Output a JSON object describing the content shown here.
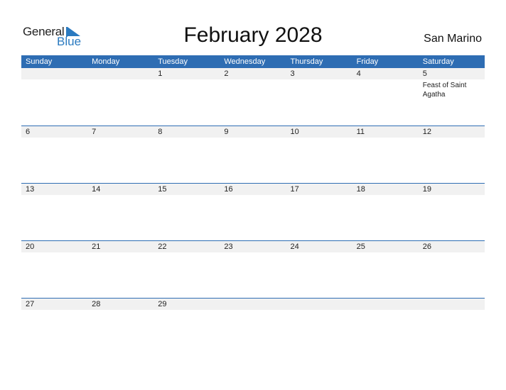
{
  "logo": {
    "general": "General",
    "blue": "Blue"
  },
  "title": "February 2028",
  "country": "San Marino",
  "colors": {
    "accent": "#2e6db3",
    "strip": "#f1f1f1"
  },
  "weekdays": [
    "Sunday",
    "Monday",
    "Tuesday",
    "Wednesday",
    "Thursday",
    "Friday",
    "Saturday"
  ],
  "weeks": [
    {
      "days": [
        "",
        "",
        "1",
        "2",
        "3",
        "4",
        "5"
      ],
      "events": [
        "",
        "",
        "",
        "",
        "",
        "",
        "Feast of Saint Agatha"
      ]
    },
    {
      "days": [
        "6",
        "7",
        "8",
        "9",
        "10",
        "11",
        "12"
      ],
      "events": [
        "",
        "",
        "",
        "",
        "",
        "",
        ""
      ]
    },
    {
      "days": [
        "13",
        "14",
        "15",
        "16",
        "17",
        "18",
        "19"
      ],
      "events": [
        "",
        "",
        "",
        "",
        "",
        "",
        ""
      ]
    },
    {
      "days": [
        "20",
        "21",
        "22",
        "23",
        "24",
        "25",
        "26"
      ],
      "events": [
        "",
        "",
        "",
        "",
        "",
        "",
        ""
      ]
    },
    {
      "days": [
        "27",
        "28",
        "29",
        "",
        "",
        "",
        ""
      ],
      "events": [
        "",
        "",
        "",
        "",
        "",
        "",
        ""
      ]
    }
  ]
}
